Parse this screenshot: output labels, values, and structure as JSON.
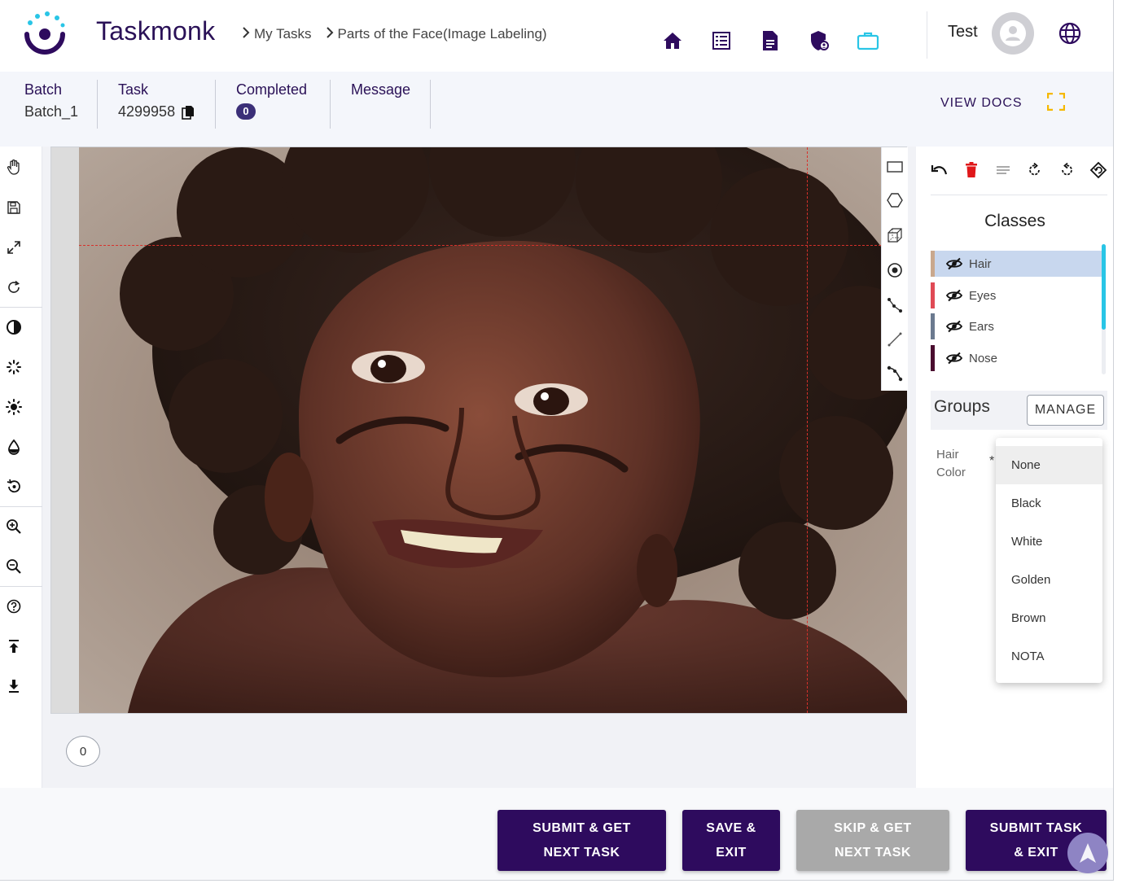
{
  "brand": {
    "name": "Taskmonk"
  },
  "breadcrumb": [
    "My Tasks",
    "Parts of the Face(Image Labeling)"
  ],
  "header": {
    "username": "Test"
  },
  "info": {
    "batch_label": "Batch",
    "batch_value": "Batch_1",
    "task_label": "Task",
    "task_value": "4299958",
    "completed_label": "Completed",
    "completed_value": "0",
    "message_label": "Message",
    "view_docs": "VIEW DOCS"
  },
  "canvas": {
    "annotation_count": "0"
  },
  "panel": {
    "classes_title": "Classes",
    "classes": [
      {
        "name": "Hair",
        "color": "#c9a88d"
      },
      {
        "name": "Eyes",
        "color": "#e04a55"
      },
      {
        "name": "Ears",
        "color": "#6b7a8f"
      },
      {
        "name": "Nose",
        "color": "#4a0d2f"
      }
    ],
    "groups_title": "Groups",
    "manage_label": "MANAGE",
    "attribute_label": "Hair Color",
    "required_mark": "*",
    "options": [
      "None",
      "Black",
      "White",
      "Golden",
      "Brown",
      "NOTA"
    ],
    "selected_option": "None"
  },
  "actions": {
    "submit_next": "SUBMIT & GET NEXT TASK",
    "save_exit": "SAVE & EXIT",
    "skip_next": "SKIP & GET NEXT TASK",
    "submit_exit": "SUBMIT TASK & EXIT"
  },
  "colors": {
    "brand": "#2e0b5e",
    "accent": "#29c5e6",
    "disabled": "#a9a9a9"
  }
}
